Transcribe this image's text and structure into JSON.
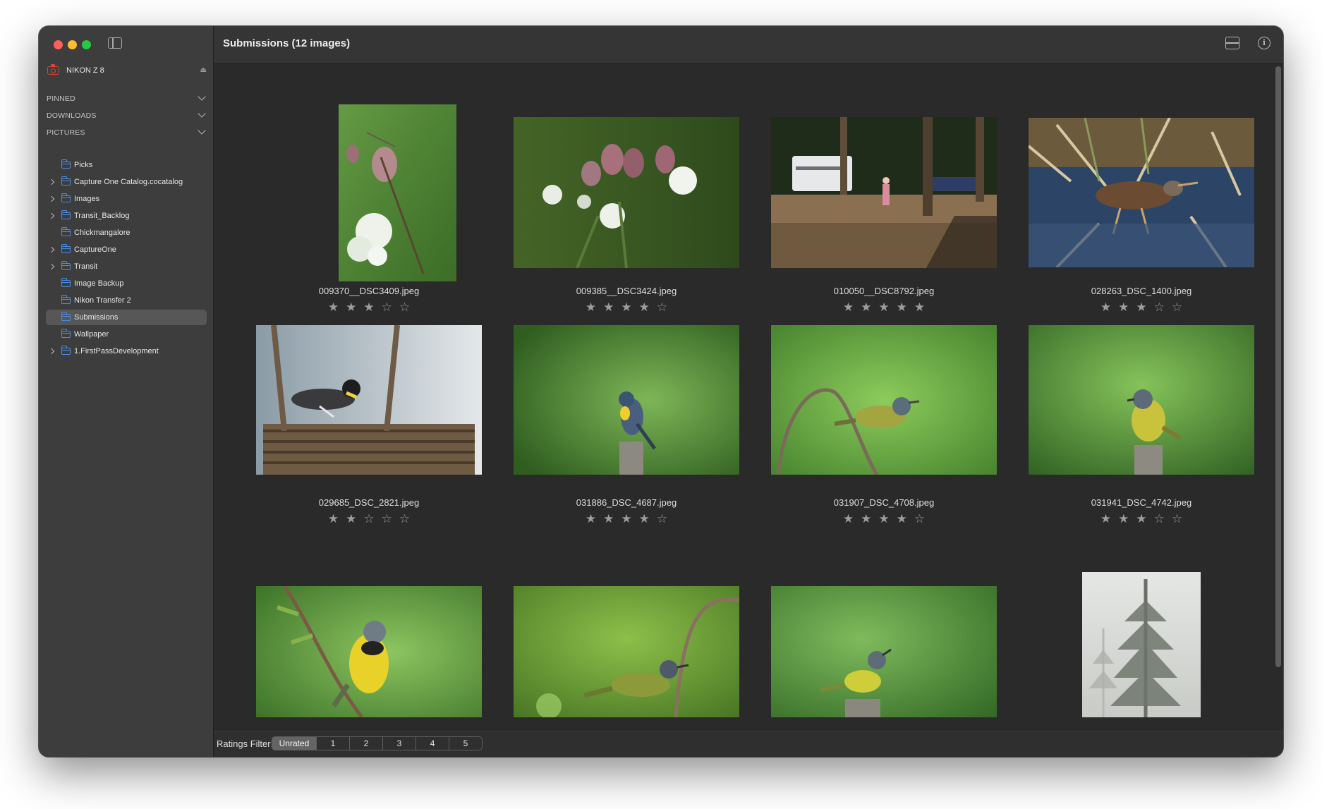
{
  "window": {
    "title": "Submissions (12 images)"
  },
  "sidebar": {
    "device": {
      "label": "NIKON Z 8",
      "icon": "camera-icon",
      "eject": "⏏"
    },
    "sections": [
      {
        "label": "PINNED"
      },
      {
        "label": "DOWNLOADS"
      },
      {
        "label": "PICTURES"
      }
    ],
    "items": [
      {
        "label": "Picks",
        "expandable": false,
        "selected": false
      },
      {
        "label": "Capture One Catalog.cocatalog",
        "expandable": true,
        "selected": false
      },
      {
        "label": "Images",
        "expandable": true,
        "selected": false
      },
      {
        "label": "Transit_Backlog",
        "expandable": true,
        "selected": false
      },
      {
        "label": "Chickmangalore",
        "expandable": false,
        "selected": false
      },
      {
        "label": "CaptureOne",
        "expandable": true,
        "selected": false
      },
      {
        "label": "Transit",
        "expandable": true,
        "selected": false
      },
      {
        "label": "Image Backup",
        "expandable": false,
        "selected": false
      },
      {
        "label": "Nikon Transfer 2",
        "expandable": false,
        "selected": false
      },
      {
        "label": "Submissions",
        "expandable": false,
        "selected": true
      },
      {
        "label": "Wallpaper",
        "expandable": false,
        "selected": false
      },
      {
        "label": "1.FirstPassDevelopment",
        "expandable": true,
        "selected": false
      }
    ]
  },
  "images": [
    {
      "name": "009370__DSC3409.jpeg",
      "rating": 3,
      "subject": "damselfly on pink flower buds"
    },
    {
      "name": "009385__DSC3424.jpeg",
      "rating": 4,
      "subject": "pink and white wildflowers"
    },
    {
      "name": "010050__DSC8792.jpeg",
      "rating": 5,
      "subject": "campsite with trailer in forest"
    },
    {
      "name": "028263_DSC_1400.jpeg",
      "rating": 3,
      "subject": "rail bird wading in reeds"
    },
    {
      "name": "029685_DSC_2821.jpeg",
      "rating": 2,
      "subject": "warbler on wicker basket"
    },
    {
      "name": "031886_DSC_4687.jpeg",
      "rating": 4,
      "subject": "parula warbler on post"
    },
    {
      "name": "031907_DSC_4708.jpeg",
      "rating": 4,
      "subject": "yellow warbler on branch"
    },
    {
      "name": "031941_DSC_4742.jpeg",
      "rating": 3,
      "subject": "yellow warbler on stump"
    },
    {
      "name": "",
      "rating": 0,
      "subject": "yellow warbler on leafy twig"
    },
    {
      "name": "",
      "rating": 0,
      "subject": "warbler on twig"
    },
    {
      "name": "",
      "rating": 0,
      "subject": "warbler singing on post"
    },
    {
      "name": "",
      "rating": 0,
      "subject": "misty forest trees"
    }
  ],
  "footer": {
    "filter_label": "Ratings Filter:",
    "options": [
      "Unrated",
      "1",
      "2",
      "3",
      "4",
      "5"
    ],
    "selected": "Unrated"
  },
  "colors": {
    "accent_folder": "#4a8ee6",
    "camera_icon": "#d9453a",
    "selection": "#575757"
  }
}
